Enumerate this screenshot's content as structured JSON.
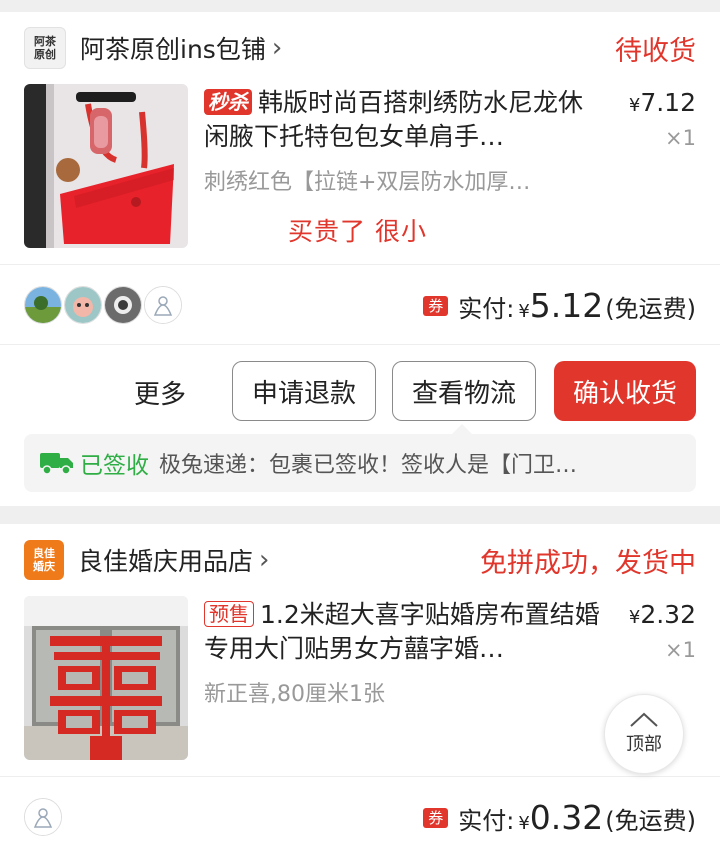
{
  "orders": [
    {
      "shop": {
        "logo_text_1": "阿茶",
        "logo_text_2": "原创",
        "name": "阿茶原创ins包铺",
        "chevron": "›",
        "status": "待收货"
      },
      "product": {
        "tag": "秒杀",
        "title": "韩版时尚百搭刺绣防水尼龙休闲腋下托特包包女单肩手…",
        "spec": "刺绣红色【拉链+双层防水加厚…",
        "price_symbol": "¥",
        "price": "7.12",
        "qty": "×1",
        "remark": "买贵了 很小"
      },
      "payment": {
        "coupon": "券",
        "label": "实付:",
        "symbol": "¥",
        "amount": "5.12",
        "note": "(免运费)"
      },
      "actions": {
        "more": "更多",
        "refund": "申请退款",
        "logistics": "查看物流",
        "confirm": "确认收货"
      },
      "tracking": {
        "status": "已签收",
        "text": "极兔速递：包裹已签收！签收人是【门卫…"
      }
    },
    {
      "shop": {
        "logo_text_1": "良佳",
        "logo_text_2": "婚庆",
        "name": "良佳婚庆用品店",
        "chevron": "›",
        "status": "免拼成功，发货中"
      },
      "product": {
        "tag": "预售",
        "title": "1.2米超大喜字贴婚房布置结婚专用大门贴男女方囍字婚…",
        "spec": "新正喜,80厘米1张",
        "price_symbol": "¥",
        "price": "2.32",
        "qty": "×1"
      },
      "payment": {
        "coupon": "券",
        "label": "实付:",
        "symbol": "¥",
        "amount": "0.32",
        "note": "(免运费)"
      }
    }
  ],
  "back_to_top": {
    "label": "顶部",
    "icon": "chevron-up-icon"
  },
  "colors": {
    "accent": "#e0362c",
    "signed": "#2fae45",
    "shop2_logo": "#ef7a1a"
  }
}
